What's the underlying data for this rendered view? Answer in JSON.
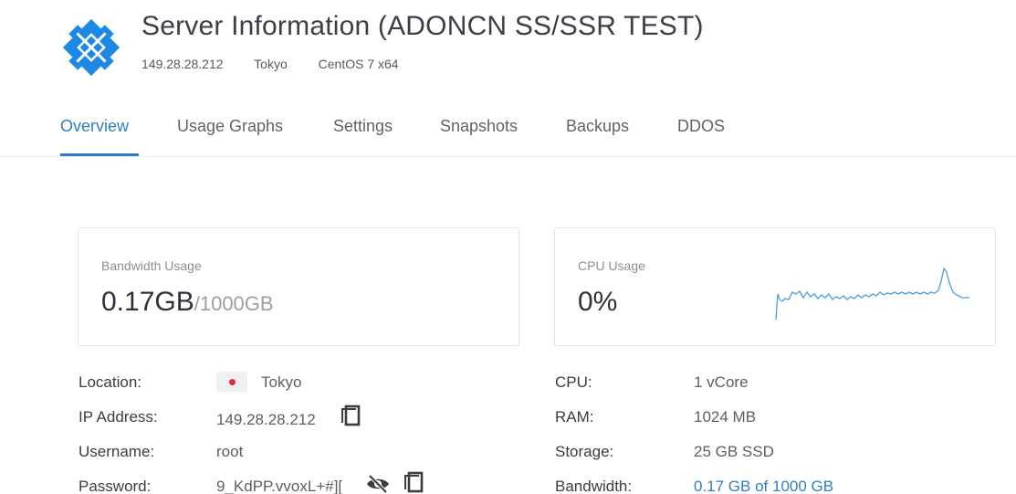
{
  "header": {
    "title": "Server Information (ADONCN SS/SSR TEST)",
    "ip": "149.28.28.212",
    "location": "Tokyo",
    "os": "CentOS 7 x64"
  },
  "tabs": [
    {
      "label": "Overview",
      "active": true
    },
    {
      "label": "Usage Graphs"
    },
    {
      "label": "Settings"
    },
    {
      "label": "Snapshots"
    },
    {
      "label": "Backups"
    },
    {
      "label": "DDOS"
    }
  ],
  "bandwidth_card": {
    "label": "Bandwidth Usage",
    "used": "0.17GB",
    "total": "/1000GB"
  },
  "cpu_card": {
    "label": "CPU Usage",
    "value": "0%"
  },
  "details_left": {
    "location_label": "Location:",
    "location_value": "Tokyo",
    "ip_label": "IP Address:",
    "ip_value": "149.28.28.212",
    "username_label": "Username:",
    "username_value": "root",
    "password_label": "Password:",
    "password_value": "9_KdPP.vvoxL+#]["
  },
  "details_right": {
    "cpu_label": "CPU:",
    "cpu_value": "1 vCore",
    "ram_label": "RAM:",
    "ram_value": "1024 MB",
    "storage_label": "Storage:",
    "storage_value": "25 GB SSD",
    "bandwidth_label": "Bandwidth:",
    "bandwidth_value": "0.17 GB of 1000 GB"
  },
  "icons": {
    "logo": "logo-icon",
    "copy": "copy-icon",
    "eye_off": "eye-slash-icon",
    "flag": "japan-flag-icon"
  },
  "colors": {
    "accent": "#2f7ec4",
    "logo": "#1e88e5",
    "flag_red": "#e02d3c"
  }
}
